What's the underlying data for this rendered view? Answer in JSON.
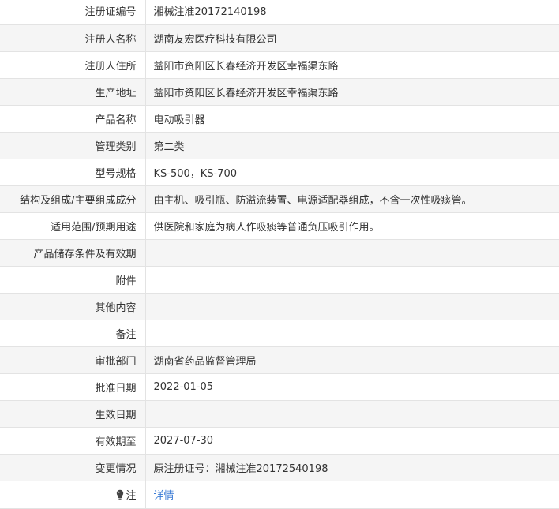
{
  "rows": [
    {
      "label": "注册证编号",
      "value": "湘械注准20172140198"
    },
    {
      "label": "注册人名称",
      "value": "湖南友宏医疗科技有限公司"
    },
    {
      "label": "注册人住所",
      "value": "益阳市资阳区长春经济开发区幸福渠东路"
    },
    {
      "label": "生产地址",
      "value": "益阳市资阳区长春经济开发区幸福渠东路"
    },
    {
      "label": "产品名称",
      "value": "电动吸引器"
    },
    {
      "label": "管理类别",
      "value": "第二类"
    },
    {
      "label": "型号规格",
      "value": "KS-500，KS-700"
    },
    {
      "label": "结构及组成/主要组成成分",
      "value": "由主机、吸引瓶、防溢流装置、电源适配器组成，不含一次性吸痰管。"
    },
    {
      "label": "适用范围/预期用途",
      "value": "供医院和家庭为病人作吸痰等普通负压吸引作用。"
    },
    {
      "label": "产品储存条件及有效期",
      "value": ""
    },
    {
      "label": "附件",
      "value": ""
    },
    {
      "label": "其他内容",
      "value": ""
    },
    {
      "label": "备注",
      "value": ""
    },
    {
      "label": "审批部门",
      "value": "湖南省药品监督管理局"
    },
    {
      "label": "批准日期",
      "value": "2022-01-05"
    },
    {
      "label": "生效日期",
      "value": ""
    },
    {
      "label": "有效期至",
      "value": "2027-07-30"
    },
    {
      "label": "变更情况",
      "value": "原注册证号：湘械注准20172540198"
    }
  ],
  "note": {
    "icon": "lightbulb-icon",
    "label": "注",
    "link_text": "详情"
  },
  "colors": {
    "border": "#e3e3e3",
    "row_alt": "#f5f5f5",
    "text": "#333333",
    "link": "#3a7bd5"
  }
}
